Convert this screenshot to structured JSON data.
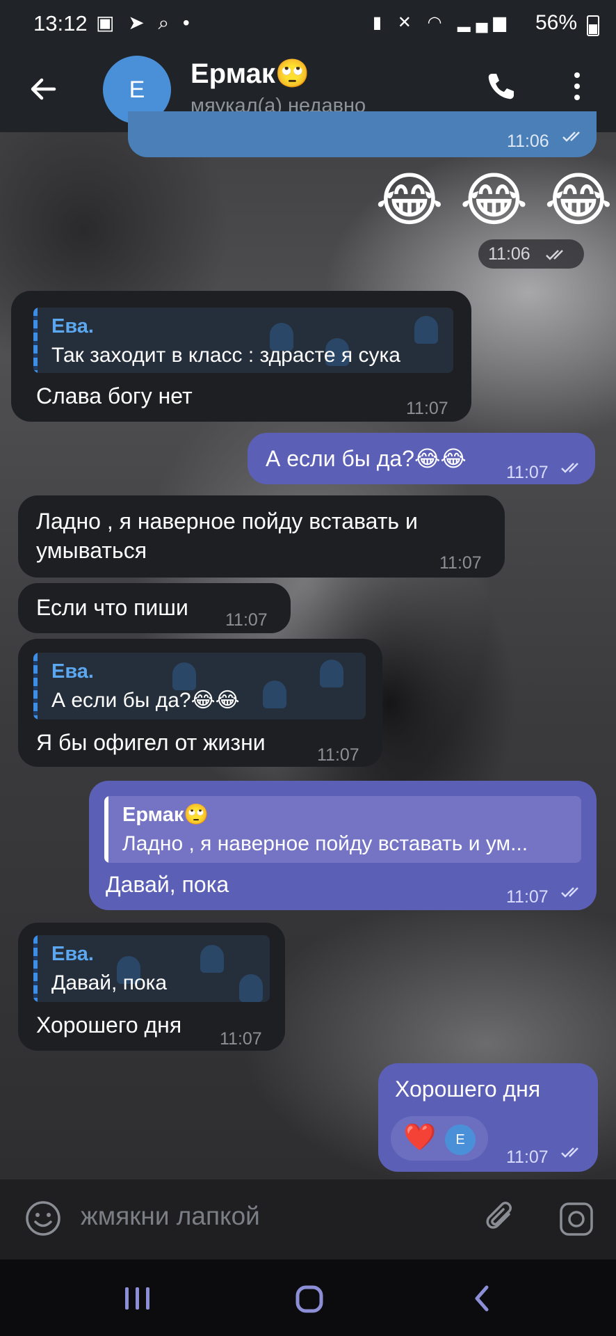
{
  "status_bar": {
    "time": "13:12",
    "battery": "56%"
  },
  "header": {
    "avatar_letter": "Е",
    "title": "Ермак🙄",
    "subtitle": "мяукал(а) недавно"
  },
  "messages": {
    "m0": {
      "time": "11:06"
    },
    "m1": {
      "emoji": "😂 😂 😂",
      "time": "11:06"
    },
    "m2": {
      "reply_name": "Ева.",
      "reply_text": "Так заходит в класс : здрасте я сука",
      "text": "Слава богу нет",
      "time": "11:07"
    },
    "m3": {
      "text": "А если бы да?😂😂",
      "time": "11:07"
    },
    "m4": {
      "text1": "Ладно , я наверное пойду вставать и",
      "text2": "умываться",
      "time": "11:07"
    },
    "m5": {
      "text": "Если что пиши",
      "time": "11:07"
    },
    "m6": {
      "reply_name": "Ева.",
      "reply_text": "А если бы да?😂😂",
      "text": "Я бы офигел от жизни",
      "time": "11:07"
    },
    "m7": {
      "reply_name": "Ермак🙄",
      "reply_text": "Ладно , я наверное пойду вставать и ум...",
      "text": "Давай, пока",
      "time": "11:07"
    },
    "m8": {
      "reply_name": "Ева.",
      "reply_text": "Давай, пока",
      "text": "Хорошего дня",
      "time": "11:07"
    },
    "m9": {
      "text": "Хорошего дня",
      "reaction": "❤️",
      "reaction_avatar": "Е",
      "time": "11:07"
    }
  },
  "input": {
    "placeholder": "жмякни лапкой"
  },
  "colors": {
    "outgoing": "#5b5fb5",
    "incoming": "#1e1f23",
    "reply_name": "#5ba8f0",
    "header": "#202327"
  }
}
